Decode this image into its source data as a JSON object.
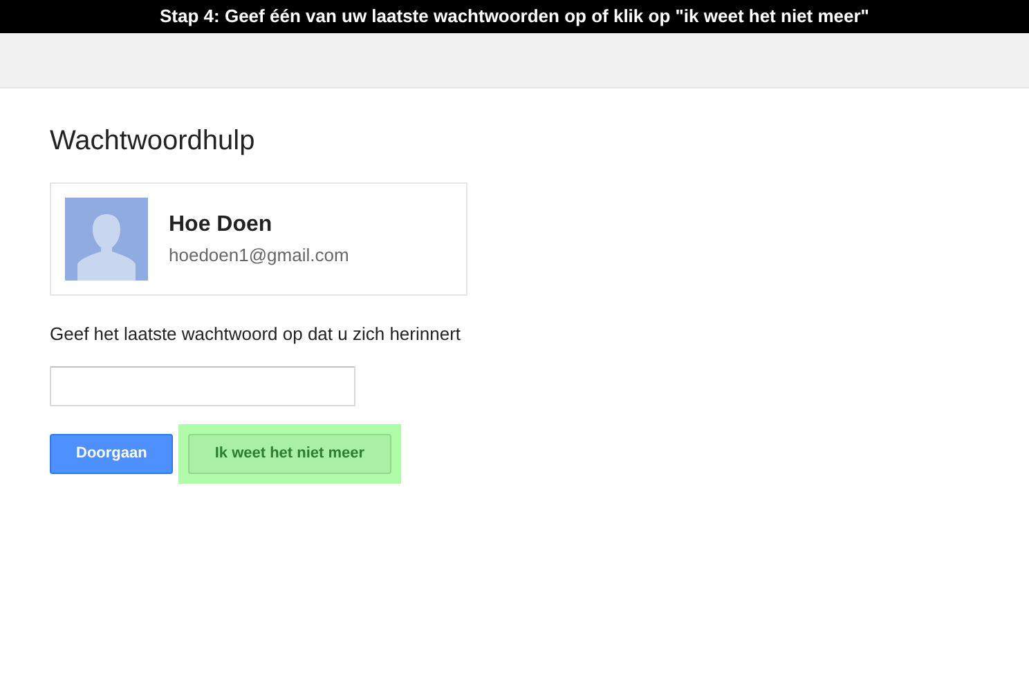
{
  "instruction_banner": "Stap 4: Geef één van uw laatste wachtwoorden op of klik op \"ik weet het niet meer\"",
  "page_title": "Wachtwoordhulp",
  "account": {
    "name": "Hoe Doen",
    "email": "hoedoen1@gmail.com"
  },
  "password_prompt": "Geef het laatste wachtwoord op dat u zich herinnert",
  "buttons": [
    {
      "label": "Doorgaan",
      "kind": "primary",
      "highlighted": false
    },
    {
      "label": "Ik weet het niet meer",
      "kind": "secondary",
      "highlighted": true
    }
  ]
}
